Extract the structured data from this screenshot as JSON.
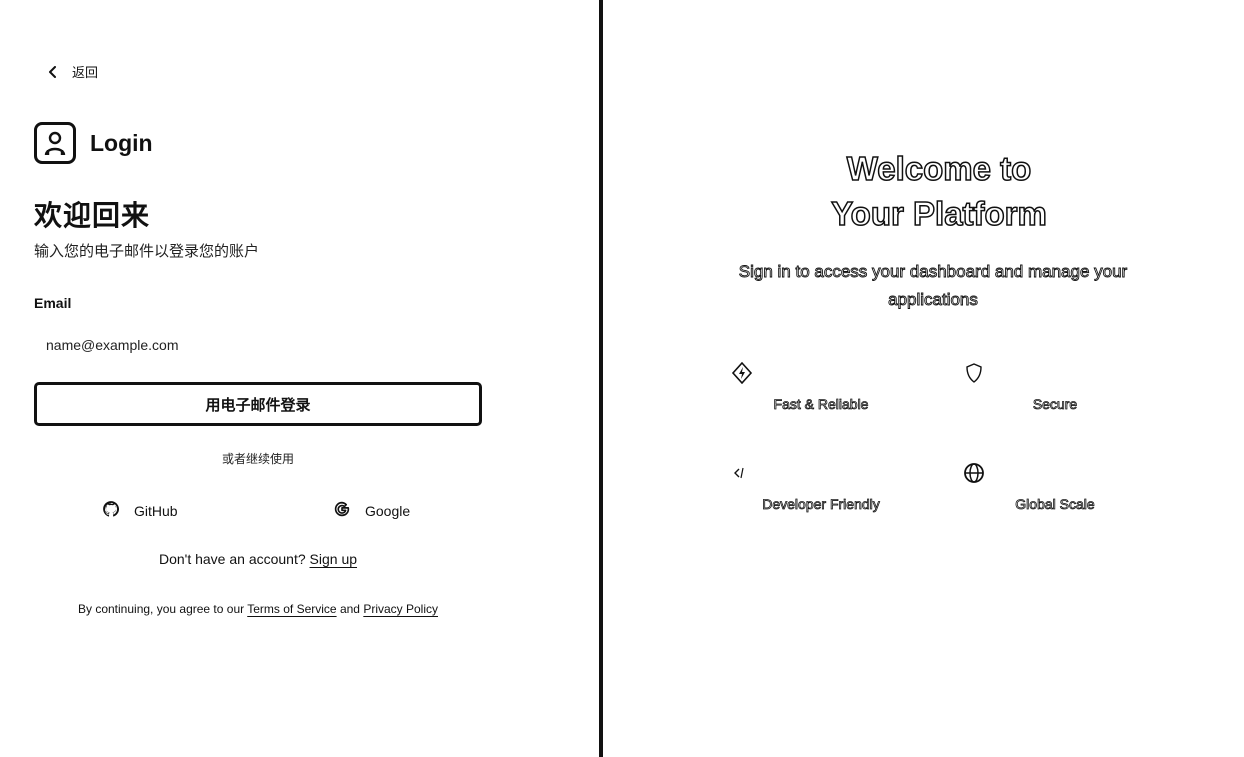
{
  "back": {
    "label": "返回",
    "icon": "chevron-left-icon"
  },
  "brand": {
    "name": "Login",
    "icon": "user-badge-icon"
  },
  "login": {
    "heading": "欢迎回来",
    "subheading": "输入您的电子邮件以登录您的账户",
    "email_label": "Email",
    "email_placeholder": "name@example.com",
    "email_value": "",
    "submit_label": "用电子邮件登录",
    "divider_text": "或者继续使用"
  },
  "social": {
    "github": {
      "label": "GitHub",
      "icon": "github-icon"
    },
    "google": {
      "label": "Google",
      "icon": "google-icon"
    }
  },
  "signup": {
    "prompt": "Don't have an account?",
    "link": "Sign up"
  },
  "legal": {
    "prefix": "By continuing, you agree to our",
    "terms": "Terms of Service",
    "conjunction": "and",
    "privacy": "Privacy Policy"
  },
  "hero": {
    "title_line1": "Welcome to",
    "title_line2": "Your Platform",
    "subtitle": "Sign in to access your dashboard and manage your applications"
  },
  "features": [
    {
      "label": "Fast & Reliable",
      "icon": "lightning-icon"
    },
    {
      "label": "Secure",
      "icon": "shield-icon"
    },
    {
      "label": "Developer Friendly",
      "icon": "code-icon"
    },
    {
      "label": "Global Scale",
      "icon": "globe-icon"
    }
  ]
}
